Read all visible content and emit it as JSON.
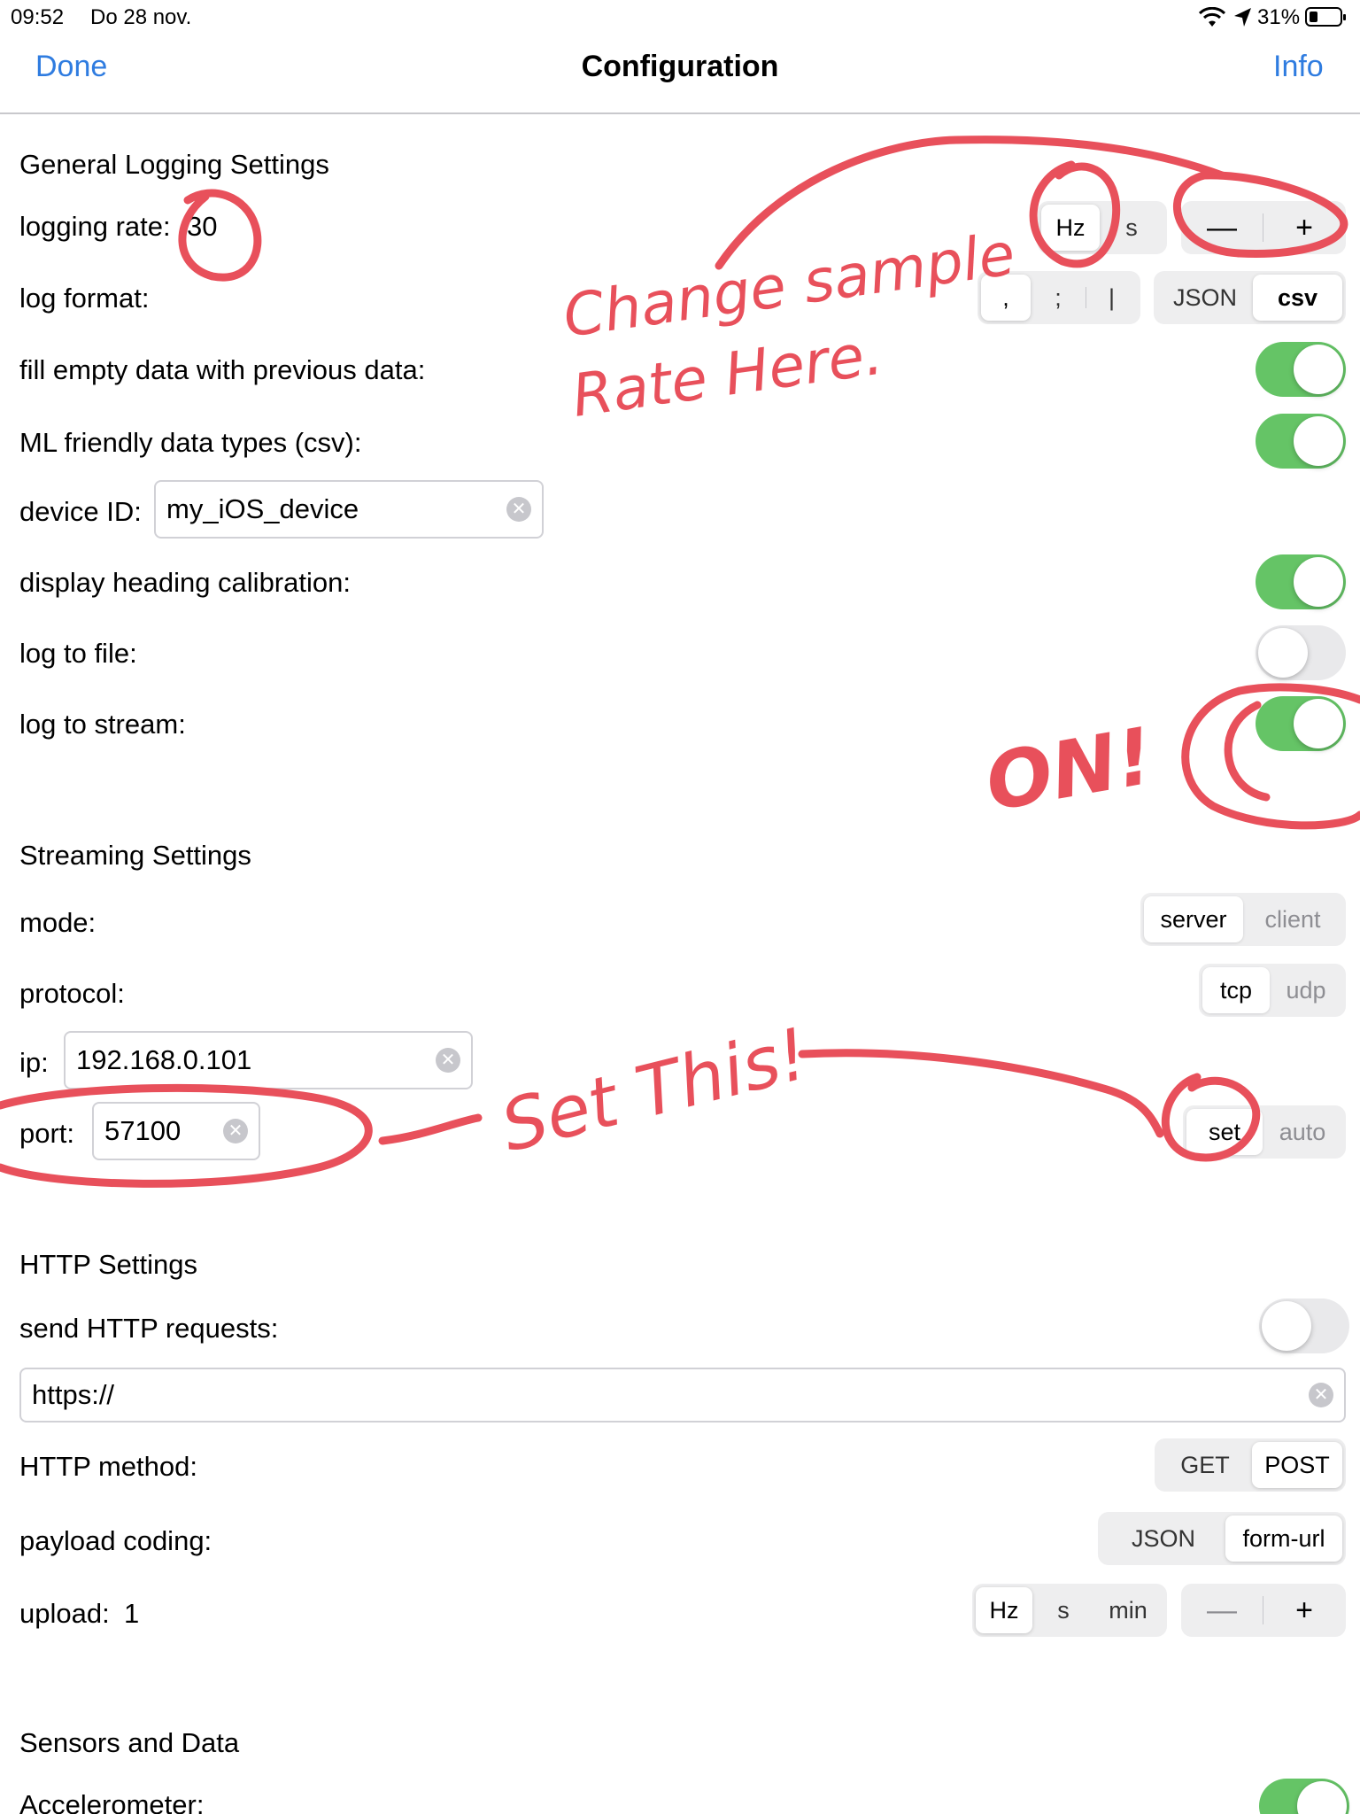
{
  "status_bar": {
    "time": "09:52",
    "date": "Do 28 nov.",
    "battery": "31%",
    "wifi_icon": "wifi-icon",
    "location_icon": "location-arrow-icon",
    "battery_icon": "battery-icon"
  },
  "nav": {
    "done": "Done",
    "title": "Configuration",
    "info": "Info",
    "accent": "#2f7ce0"
  },
  "general": {
    "title": "General Logging Settings",
    "logging_rate_label": "logging rate:",
    "logging_rate_value": "30",
    "rate_units": [
      "Hz",
      "s"
    ],
    "rate_selected": "Hz",
    "stepper_minus": "—",
    "stepper_plus": "+",
    "log_format_label": "log format:",
    "separators": [
      ",",
      ";",
      "|"
    ],
    "separator_selected": ",",
    "formats": [
      "JSON",
      "csv"
    ],
    "format_selected": "csv",
    "fill_empty_label": "fill empty data with previous data:",
    "fill_empty_on": true,
    "ml_friendly_label": "ML friendly data types (csv):",
    "ml_friendly_on": true,
    "device_id_label": "device ID:",
    "device_id_value": "my_iOS_device",
    "heading_calib_label": "display heading calibration:",
    "heading_calib_on": true,
    "log_to_file_label": "log to file:",
    "log_to_file_on": false,
    "log_to_stream_label": "log to stream:",
    "log_to_stream_on": true
  },
  "streaming": {
    "title": "Streaming Settings",
    "mode_label": "mode:",
    "modes": [
      "server",
      "client"
    ],
    "protocol_label": "protocol:",
    "protocols": [
      "tcp",
      "udp"
    ],
    "ip_label": "ip:",
    "ip_value": "192.168.0.101",
    "port_label": "port:",
    "port_value": "57100",
    "port_modes": [
      "set",
      "auto"
    ]
  },
  "http": {
    "title": "HTTP Settings",
    "send_label": "send HTTP requests:",
    "send_on": false,
    "url_value": "https://",
    "method_label": "HTTP method:",
    "methods": [
      "GET",
      "POST"
    ],
    "method_selected": "POST",
    "payload_label": "payload coding:",
    "payloads": [
      "JSON",
      "form-url"
    ],
    "payload_selected": "form-url",
    "upload_label": "upload:",
    "upload_value": "1",
    "upload_units": [
      "Hz",
      "s",
      "min"
    ],
    "upload_selected": "Hz",
    "stepper_minus": "—",
    "stepper_plus": "+"
  },
  "sensors": {
    "title": "Sensors and Data",
    "accelerometer_label": "Accelerometer:",
    "accelerometer_on": true
  },
  "annotations": {
    "color": "#e8505b",
    "note_sample_rate": "Change sample Rate Here.",
    "note_on": "ON!",
    "note_set_this": "Set This!"
  },
  "colors": {
    "toggle_on": "#65c466",
    "toggle_off": "#e9e9eb"
  }
}
